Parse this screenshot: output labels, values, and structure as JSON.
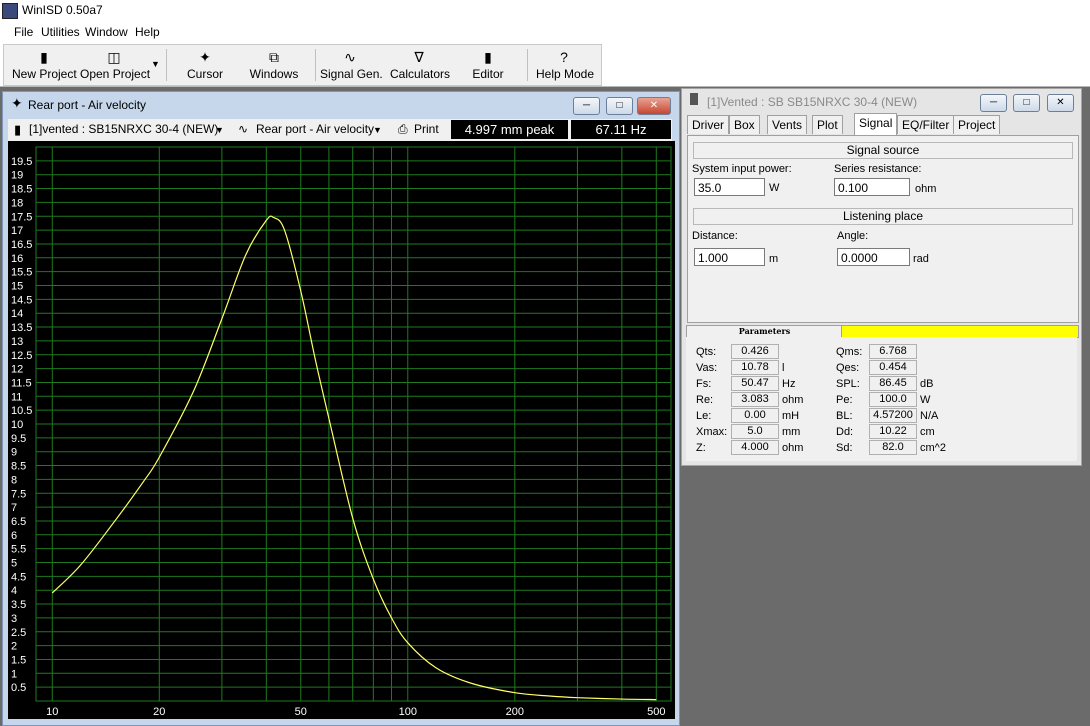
{
  "app": {
    "title": "WinISD 0.50a7"
  },
  "menu": [
    "File",
    "Utilities",
    "Window",
    "Help"
  ],
  "toolbar": {
    "new_project": "New Project",
    "open_project": "Open Project",
    "cursor": "Cursor",
    "windows": "Windows",
    "signal_gen": "Signal Gen.",
    "calculators": "Calculators",
    "editor": "Editor",
    "help_mode": "Help Mode"
  },
  "plot_window": {
    "title": "Rear port - Air velocity",
    "project_select": "[1]vented : SB15NRXC 30-4 (NEW)",
    "graph_select": "Rear port - Air velocity",
    "print_label": "Print",
    "readout_value": "4.997 mm peak",
    "readout_freq": "67.11 Hz"
  },
  "chart_data": {
    "type": "line",
    "x_scale": "log",
    "xlim": [
      9,
      550
    ],
    "ylim": [
      0,
      20
    ],
    "grid": true,
    "line_color": "#ffff66",
    "grid_color": "#1f7a1f",
    "x_tick_labels": [
      "10",
      "20",
      "50",
      "100",
      "200",
      "500"
    ],
    "y_tick_labels": [
      "0.5",
      "1",
      "1.5",
      "2",
      "2.5",
      "3",
      "3.5",
      "4",
      "4.5",
      "5",
      "5.5",
      "6",
      "6.5",
      "7",
      "7.5",
      "8",
      "8.5",
      "9",
      "9.5",
      "10",
      "10.5",
      "11",
      "11.5",
      "12",
      "12.5",
      "13",
      "13.5",
      "14",
      "14.5",
      "15",
      "15.5",
      "16",
      "16.5",
      "17",
      "17.5",
      "18",
      "18.5",
      "19",
      "19.5"
    ],
    "series": [
      {
        "x": [
          10,
          12,
          15,
          18,
          20,
          25,
          30,
          35,
          40,
          42,
          45,
          50,
          55,
          60,
          70,
          80,
          90,
          100,
          120,
          150,
          200,
          250,
          300,
          400,
          500
        ],
        "y": [
          3.9,
          4.9,
          6.5,
          7.9,
          8.8,
          11.2,
          13.8,
          16.1,
          17.35,
          17.45,
          17.0,
          14.8,
          12.3,
          10.2,
          6.6,
          4.4,
          3.0,
          2.1,
          1.2,
          0.65,
          0.3,
          0.18,
          0.12,
          0.07,
          0.05
        ]
      }
    ]
  },
  "props_window": {
    "title": "[1]Vented : SB SB15NRXC 30-4 (NEW)",
    "tabs": [
      "Driver",
      "Box",
      "Vents",
      "Plot",
      "Signal",
      "EQ/Filter",
      "Project"
    ],
    "active_tab": "Signal",
    "signal_source_header": "Signal source",
    "input_power_label": "System input power:",
    "input_power_value": "35.0",
    "input_power_unit": "W",
    "series_res_label": "Series resistance:",
    "series_res_value": "0.100",
    "series_res_unit": "ohm",
    "listening_header": "Listening place",
    "distance_label": "Distance:",
    "distance_value": "1.000",
    "distance_unit": "m",
    "angle_label": "Angle:",
    "angle_value": "0.0000",
    "angle_unit": "rad",
    "params_tab": "Parameters",
    "params_left": [
      {
        "label": "Qts:",
        "value": "0.426",
        "unit": ""
      },
      {
        "label": "Vas:",
        "value": "10.78",
        "unit": "l"
      },
      {
        "label": "Fs:",
        "value": "50.47",
        "unit": "Hz"
      },
      {
        "label": "Re:",
        "value": "3.083",
        "unit": "ohm"
      },
      {
        "label": "Le:",
        "value": "0.00",
        "unit": "mH"
      },
      {
        "label": "Xmax:",
        "value": "5.0",
        "unit": "mm"
      },
      {
        "label": "Z:",
        "value": "4.000",
        "unit": "ohm"
      }
    ],
    "params_right": [
      {
        "label": "Qms:",
        "value": "6.768",
        "unit": ""
      },
      {
        "label": "Qes:",
        "value": "0.454",
        "unit": ""
      },
      {
        "label": "SPL:",
        "value": "86.45",
        "unit": "dB"
      },
      {
        "label": "Pe:",
        "value": "100.0",
        "unit": "W"
      },
      {
        "label": "BL:",
        "value": "4.57200",
        "unit": "N/A"
      },
      {
        "label": "Dd:",
        "value": "10.22",
        "unit": "cm"
      },
      {
        "label": "Sd:",
        "value": "82.0",
        "unit": "cm^2"
      }
    ]
  }
}
